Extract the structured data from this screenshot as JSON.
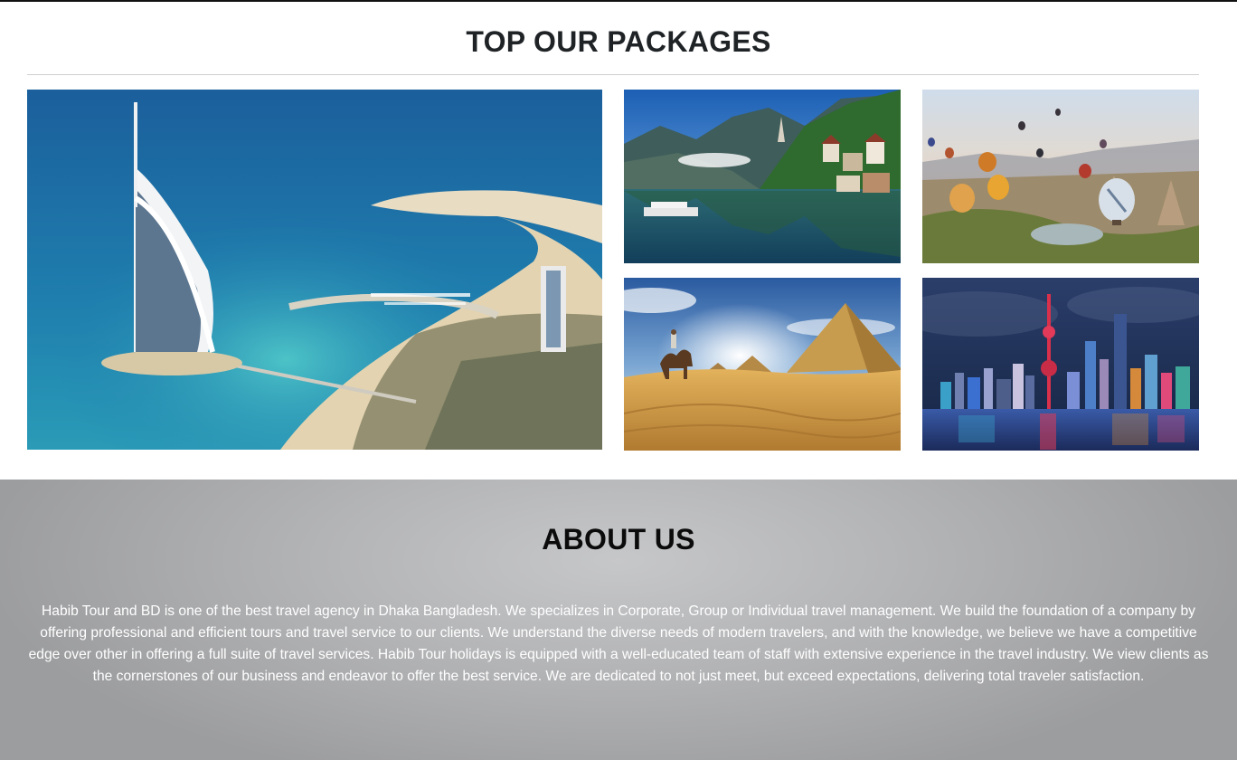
{
  "packages": {
    "title": "TOP OUR PACKAGES",
    "tiles": [
      {
        "name": "dubai-burj-al-arab",
        "icon": "photo"
      },
      {
        "name": "alpine-lake-village",
        "icon": "photo"
      },
      {
        "name": "hot-air-balloons",
        "icon": "photo"
      },
      {
        "name": "egypt-pyramids-camel",
        "icon": "photo"
      },
      {
        "name": "night-city-skyline",
        "icon": "photo"
      }
    ]
  },
  "about": {
    "title": "ABOUT US",
    "body": "Habib Tour and BD is one of the best travel agency in Dhaka Bangladesh. We specializes in Corporate, Group or Individual travel management. We build the foundation of a company by offering professional and efficient tours and travel service to our clients. We understand the diverse needs of modern travelers, and with the knowledge, we believe we have a competitive edge over other in offering a full suite of travel services. Habib Tour holidays is equipped with a well-educated team of staff with extensive experience in the travel industry. We view clients as the cornerstones of our business and endeavor to offer the best service. We are dedicated to not just meet, but exceed expectations, delivering total traveler satisfaction."
  },
  "colors": {
    "heading": "#1f2326",
    "about_bg": "#b4b5b7",
    "about_text": "#ffffff"
  }
}
